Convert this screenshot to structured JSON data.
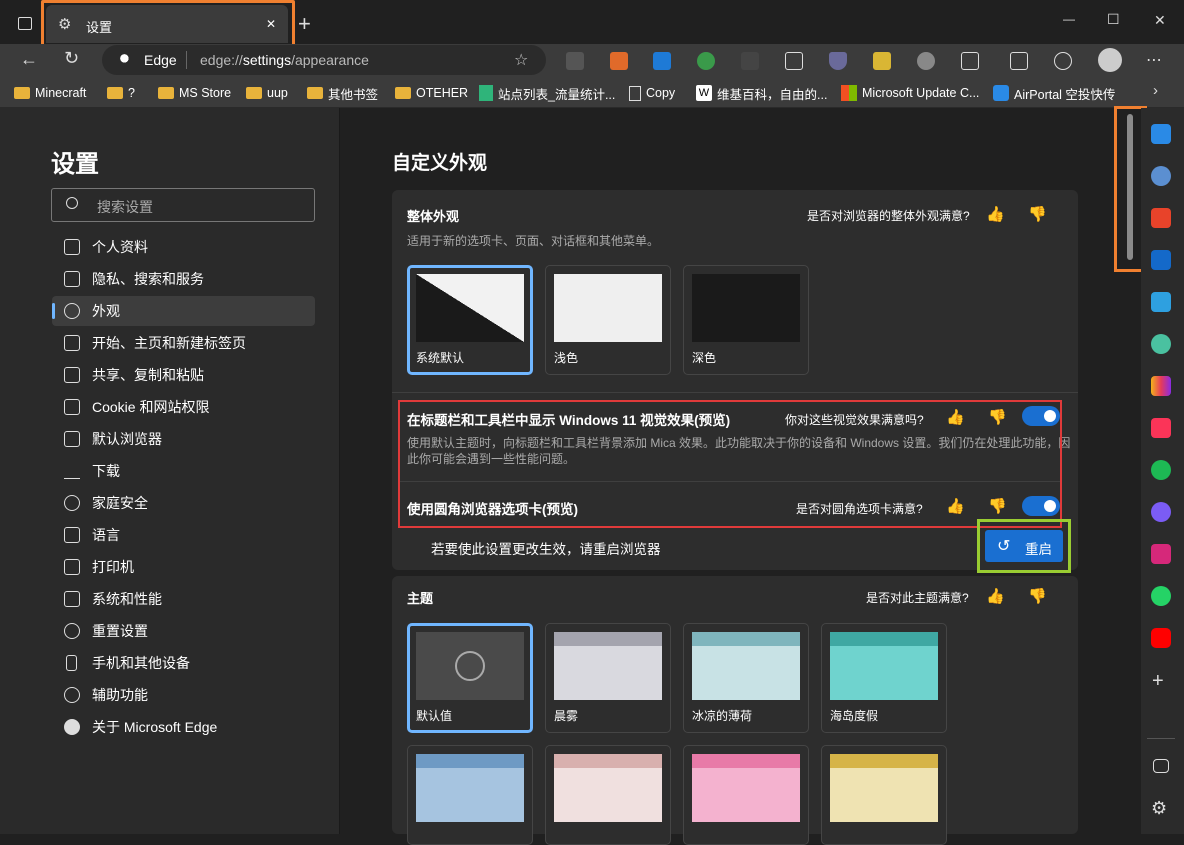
{
  "tab": {
    "title": "设置",
    "close": "✕",
    "new": "+"
  },
  "window": {
    "minimize": "—",
    "maximize": "☐",
    "close": "✕"
  },
  "address": {
    "site": "Edge",
    "url_host": "edge://",
    "url_path": "settings",
    "url_rest": "/appearance"
  },
  "bookmarks": [
    "Minecraft",
    "?",
    "MS Store",
    "uup",
    "其他书签",
    "OTEHER",
    "站点列表_流量统计...",
    "Copy",
    "维基百科，自由的...",
    "Microsoft Update C...",
    "AirPortal 空投快传"
  ],
  "left": {
    "title": "设置",
    "search_placeholder": "搜索设置",
    "items": [
      "个人资料",
      "隐私、搜索和服务",
      "外观",
      "开始、主页和新建标签页",
      "共享、复制和粘贴",
      "Cookie 和网站权限",
      "默认浏览器",
      "下载",
      "家庭安全",
      "语言",
      "打印机",
      "系统和性能",
      "重置设置",
      "手机和其他设备",
      "辅助功能",
      "关于 Microsoft Edge"
    ]
  },
  "main": {
    "title": "自定义外观",
    "overall": {
      "title": "整体外观",
      "desc": "适用于新的选项卡、页面、对话框和其他菜单。",
      "feedback": "是否对浏览器的整体外观满意?",
      "options": [
        "系统默认",
        "浅色",
        "深色"
      ]
    },
    "win11": {
      "title": "在标题栏和工具栏中显示 Windows 11 视觉效果(预览)",
      "feedback": "你对这些视觉效果满意吗?",
      "desc": "使用默认主题时，向标题栏和工具栏背景添加 Mica 效果。此功能取决于你的设备和 Windows 设置。我们仍在处理此功能，因此你可能会遇到一些性能问题。",
      "on": true
    },
    "rounded": {
      "title": "使用圆角浏览器选项卡(预览)",
      "feedback": "是否对圆角选项卡满意?",
      "on": true
    },
    "restart": {
      "text": "若要使此设置更改生效，请重启浏览器",
      "button": "重启"
    },
    "theme": {
      "title": "主题",
      "feedback": "是否对此主题满意?",
      "options": [
        "默认值",
        "晨雾",
        "冰凉的薄荷",
        "海岛度假"
      ]
    }
  },
  "colors": {
    "accent": "#1a6fd1",
    "highlight_orange": "#f08030",
    "highlight_red": "#e03a3a",
    "highlight_green": "#9acd32"
  }
}
